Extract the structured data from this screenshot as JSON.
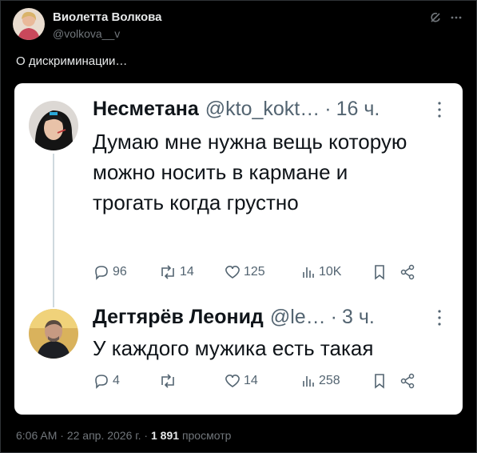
{
  "post": {
    "author_name": "Виолетта Волкова",
    "author_handle": "@volkova__v",
    "text": "О дискриминации…",
    "footer": {
      "time": "6:06 AM",
      "sep1": " · ",
      "date": "22 апр. 2026 г.",
      "sep2": " · ",
      "views_count": "1 891",
      "views_label": "просмотр"
    }
  },
  "replies": [
    {
      "name": "Несметана",
      "handle": "@kto_kokt…",
      "dot": "·",
      "time": "16 ч.",
      "text": "Думаю мне нужна вещь которую можно носить в кармане и трогать когда грустно",
      "stats": {
        "replies": "96",
        "retweets": "14",
        "likes": "125",
        "views": "10K"
      }
    },
    {
      "name": "Дегтярёв Леонид",
      "handle": "@le…",
      "dot": "·",
      "time": "3 ч.",
      "text": "У каждого мужика есть такая",
      "stats": {
        "replies": "4",
        "retweets": "",
        "likes": "14",
        "views": "258"
      }
    }
  ],
  "colors": {
    "accent": "#1d9bf0",
    "muted": "#536471",
    "card_bg": "#ffffff",
    "page_bg": "#000000"
  },
  "icons": [
    "grok-icon",
    "more-icon",
    "reply-icon",
    "retweet-icon",
    "like-icon",
    "views-icon",
    "bookmark-icon",
    "share-icon"
  ]
}
